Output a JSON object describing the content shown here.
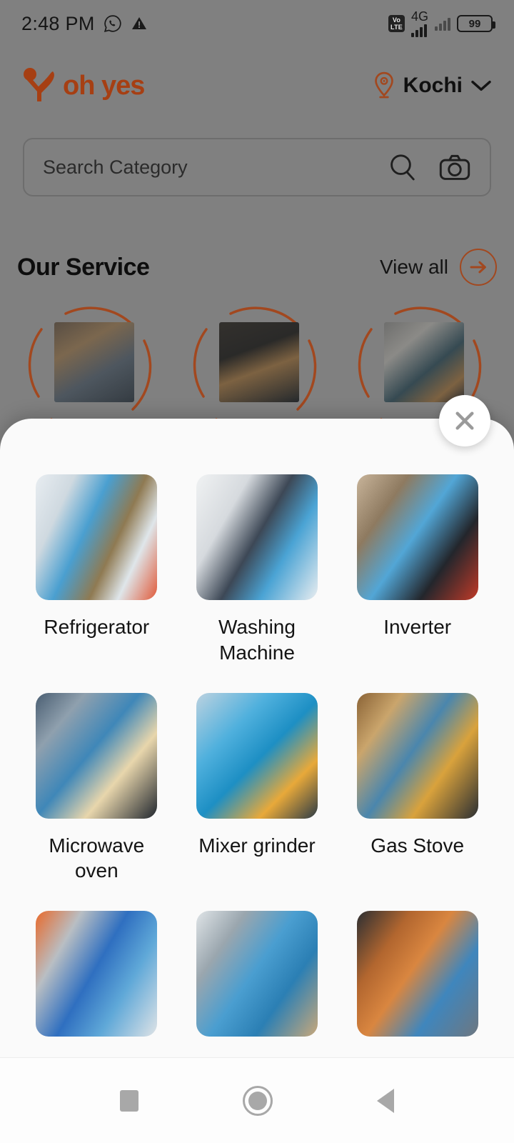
{
  "status_bar": {
    "time": "2:48 PM",
    "whatsapp_icon": "whatsapp-icon",
    "warning_icon": "warning-triangle-icon",
    "volte_top": "Vo",
    "volte_bottom": "LTE",
    "network": "4G",
    "battery_level": "99"
  },
  "header": {
    "brand_name": "oh yes",
    "logo_icon": "oh-yes-logo-icon",
    "location_icon": "location-pin-icon",
    "location": "Kochi",
    "chevron_icon": "chevron-down-icon"
  },
  "search": {
    "placeholder": "Search Category",
    "value": "",
    "search_icon": "search-icon",
    "camera_icon": "camera-icon"
  },
  "our_service": {
    "title": "Our Service",
    "view_all_label": "View all",
    "arrow_icon": "arrow-right-icon",
    "items": [
      {
        "name": "service-circle-1"
      },
      {
        "name": "service-circle-2"
      },
      {
        "name": "service-circle-3"
      }
    ]
  },
  "modal": {
    "close_icon": "close-x-icon",
    "categories": [
      {
        "label": "Refrigerator",
        "image": "refrigerator-repair-photo"
      },
      {
        "label": "Washing Machine",
        "image": "washing-machine-repair-photo"
      },
      {
        "label": "Inverter",
        "image": "inverter-repair-photo"
      },
      {
        "label": "Microwave oven",
        "image": "microwave-oven-repair-photo"
      },
      {
        "label": "Mixer grinder",
        "image": "mixer-grinder-repair-photo"
      },
      {
        "label": "Gas Stove",
        "image": "gas-stove-repair-photo"
      },
      {
        "label": "",
        "image": "water-heater-repair-photo"
      },
      {
        "label": "",
        "image": "water-purifier-repair-photo"
      },
      {
        "label": "",
        "image": "chimney-repair-photo"
      }
    ]
  },
  "navbar": {
    "recents_icon": "recents-square-icon",
    "home_icon": "home-circle-icon",
    "back_icon": "back-triangle-icon"
  },
  "colors": {
    "brand": "#a63f13",
    "accent": "#a2481f",
    "sheet_bg": "#fafafa",
    "overlay": "#808080",
    "text": "#141414"
  }
}
